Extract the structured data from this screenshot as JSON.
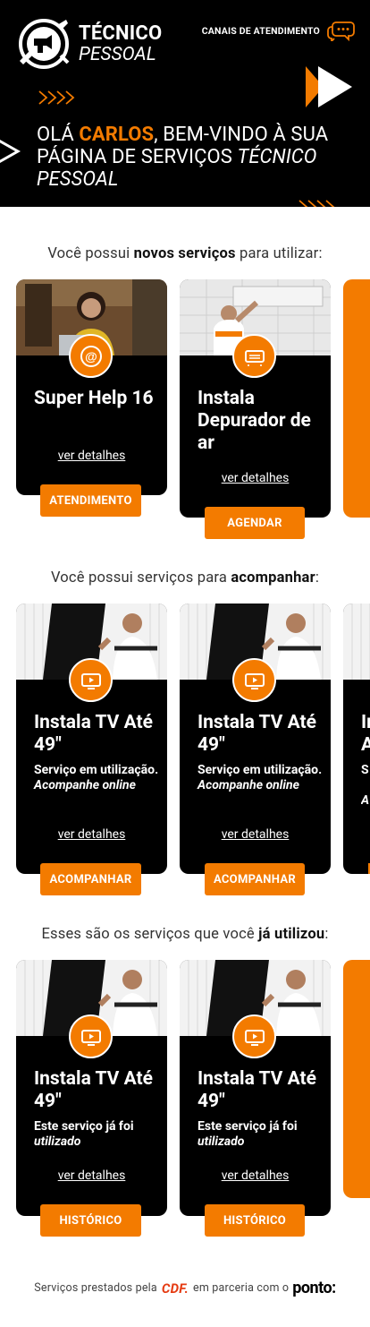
{
  "header": {
    "brand_line1": "TÉCNICO",
    "brand_line2": "PESSOAL",
    "channels_label": "CANAIS DE ATENDIMENTO",
    "greeting_prefix": "OLÁ ",
    "user_name": "CARLOS",
    "greeting_mid": ", BEM-VINDO À SUA PÁGINA DE SERVIÇOS ",
    "greeting_brand": "TÉCNICO PESSOAL"
  },
  "sections": {
    "new": {
      "pre": "Você possui ",
      "bold": "novos serviços",
      "post": " para utilizar:"
    },
    "follow": {
      "pre": "Você possui serviços para ",
      "bold": "acompanhar",
      "post": ":"
    },
    "used": {
      "pre": "Esses são os serviços que você ",
      "bold": "já utilizou",
      "post": ":"
    }
  },
  "cards": {
    "new": [
      {
        "title": "Super Help 16",
        "link": "ver detalhes",
        "button": "ATENDIMENTO",
        "icon": "at-sign-icon"
      },
      {
        "title": "Instala Depurador de ar",
        "link": "ver detalhes",
        "button": "AGENDAR",
        "icon": "air-purifier-icon"
      }
    ],
    "follow": [
      {
        "title": "Instala TV Até 49\"",
        "desc": "Serviço em utilização.",
        "desc_em": "Acompanhe online",
        "link": "ver detalhes",
        "button": "ACOMPANHAR",
        "icon": "tv-play-icon"
      },
      {
        "title": "Instala TV Até 49\"",
        "desc": "Serviço em utilização.",
        "desc_em": "Acompanhe online",
        "link": "ver detalhes",
        "button": "ACOMPANHAR",
        "icon": "tv-play-icon"
      }
    ],
    "used": [
      {
        "title": "Instala TV Até 49\"",
        "desc": "Este serviço já foi",
        "desc_em": "utilizado",
        "link": "ver detalhes",
        "button": "HISTÓRICO",
        "icon": "tv-play-icon"
      },
      {
        "title": "Instala TV Até 49\"",
        "desc": "Este serviço já foi",
        "desc_em": "utilizado",
        "link": "ver detalhes",
        "button": "HISTÓRICO",
        "icon": "tv-play-icon"
      }
    ],
    "peek_follow": {
      "title": "In A",
      "desc": "S u",
      "desc_em": "A"
    }
  },
  "footer": {
    "pre": "Serviços prestados pela",
    "cdf": "CDF.",
    "mid": "em parceria com o",
    "ponto": "ponto:"
  },
  "colors": {
    "accent": "#f37b00",
    "dark": "#000000"
  }
}
